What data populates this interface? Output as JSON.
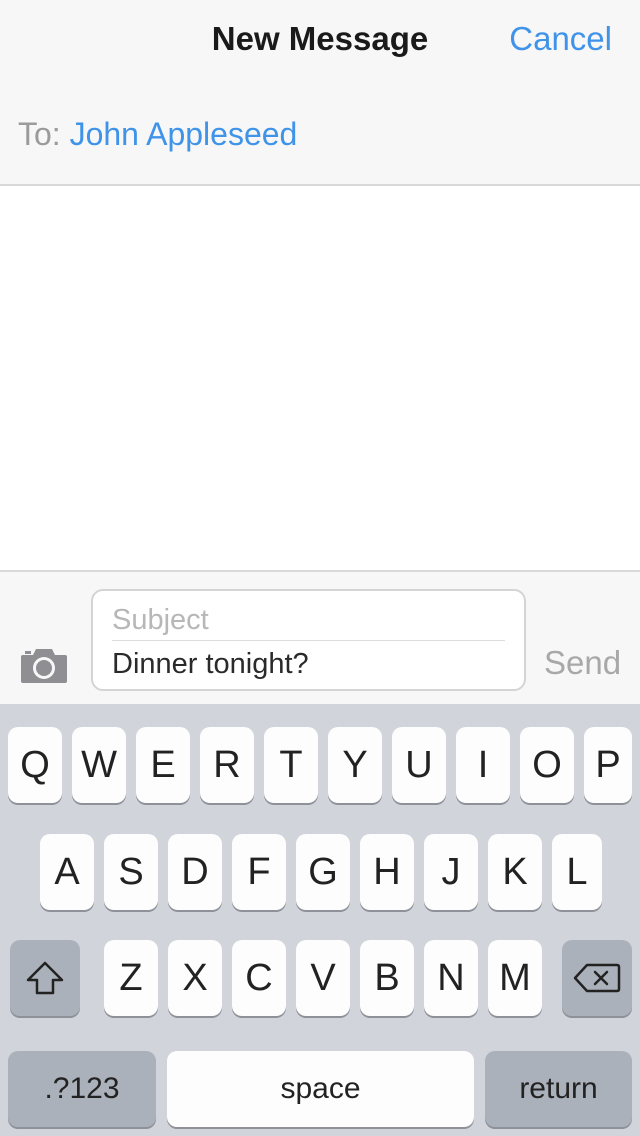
{
  "navbar": {
    "title": "New Message",
    "cancel": "Cancel",
    "to_label": "To:",
    "recipient": "John Appleseed"
  },
  "compose": {
    "subject_placeholder": "Subject",
    "message": "Dinner tonight?",
    "send": "Send",
    "camera_icon": "camera-icon"
  },
  "keyboard": {
    "row1": [
      "Q",
      "W",
      "E",
      "R",
      "T",
      "Y",
      "U",
      "I",
      "O",
      "P"
    ],
    "row2": [
      "A",
      "S",
      "D",
      "F",
      "G",
      "H",
      "J",
      "K",
      "L"
    ],
    "row3": [
      "Z",
      "X",
      "C",
      "V",
      "B",
      "N",
      "M"
    ],
    "shift_icon": "shift-icon",
    "delete_icon": "delete-icon",
    "numbers": ".?123",
    "space": "space",
    "return": "return"
  },
  "colors": {
    "accent": "#3f93e8",
    "keyboard_bg": "#d1d5db"
  }
}
